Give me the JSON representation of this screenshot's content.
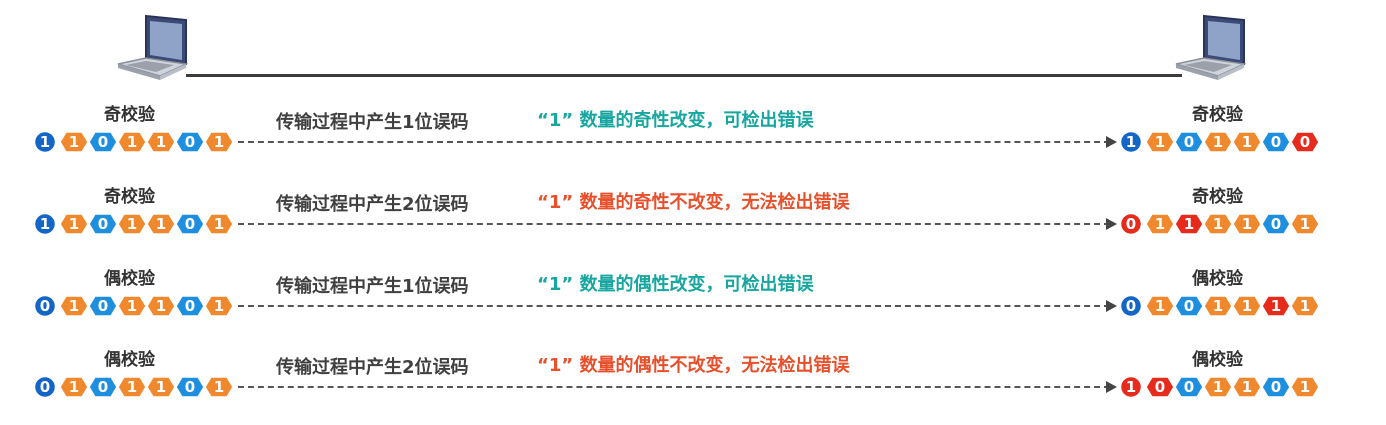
{
  "colors": {
    "parity_blue": "#1366c6",
    "bit_blue": "#1e8fdf",
    "bit_orange": "#f0892e",
    "bit_error": "#e62a1c",
    "teal_text": "#17a6a0",
    "red_text": "#e8502c"
  },
  "icons": {
    "sender": "laptop-icon",
    "receiver": "laptop-icon"
  },
  "rows": [
    {
      "check_left": "奇校验",
      "check_right": "奇校验",
      "process": "传输过程中产生1位误码",
      "result": "“1” 数量的奇性改变，可检出错误",
      "result_color": "teal",
      "sent": [
        "1",
        "1",
        "0",
        "1",
        "1",
        "0",
        "1"
      ],
      "received": [
        "1",
        "1",
        "0",
        "1",
        "1",
        "0",
        "0"
      ],
      "received_errors": [
        6
      ]
    },
    {
      "check_left": "奇校验",
      "check_right": "奇校验",
      "process": "传输过程中产生2位误码",
      "result": "“1” 数量的奇性不改变，无法检出错误",
      "result_color": "red",
      "sent": [
        "1",
        "1",
        "0",
        "1",
        "1",
        "0",
        "1"
      ],
      "received": [
        "0",
        "1",
        "1",
        "1",
        "1",
        "0",
        "1"
      ],
      "received_errors": [
        0,
        2
      ]
    },
    {
      "check_left": "偶校验",
      "check_right": "偶校验",
      "process": "传输过程中产生1位误码",
      "result": "“1” 数量的偶性改变，可检出错误",
      "result_color": "teal",
      "sent": [
        "0",
        "1",
        "0",
        "1",
        "1",
        "0",
        "1"
      ],
      "received": [
        "0",
        "1",
        "0",
        "1",
        "1",
        "1",
        "1"
      ],
      "received_errors": [
        5
      ]
    },
    {
      "check_left": "偶校验",
      "check_right": "偶校验",
      "process": "传输过程中产生2位误码",
      "result": "“1” 数量的偶性不改变，无法检出错误",
      "result_color": "red",
      "sent": [
        "0",
        "1",
        "0",
        "1",
        "1",
        "0",
        "1"
      ],
      "received": [
        "1",
        "0",
        "0",
        "1",
        "1",
        "0",
        "1"
      ],
      "received_errors": [
        0,
        1
      ]
    }
  ]
}
